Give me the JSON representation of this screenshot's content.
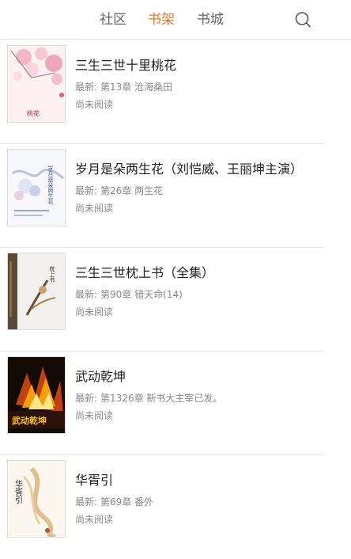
{
  "tabs": [
    {
      "label": "社区"
    },
    {
      "label": "书架"
    },
    {
      "label": "书城"
    }
  ],
  "active_tab": "书架",
  "accent_color": "#f07a2c",
  "search_icon": "search-icon",
  "books": [
    {
      "title": "三生三世十里桃花",
      "latest_prefix": "最新:",
      "latest_chapter": "第13章 沧海桑田",
      "status": "尚未阅读",
      "cover_text": "桃花"
    },
    {
      "title": "岁月是朵两生花（刘恺威、王丽坤主演）",
      "latest_prefix": "最新:",
      "latest_chapter": "第26章 两生花",
      "status": "尚未阅读",
      "cover_text": "岁月是朵两生花"
    },
    {
      "title": "三生三世枕上书（全集）",
      "latest_prefix": "最新:",
      "latest_chapter": "第90章 错天命(14)",
      "status": "尚未阅读",
      "cover_text": "枕上书"
    },
    {
      "title": "武动乾坤",
      "latest_prefix": "最新:",
      "latest_chapter": "第1326章 新书大主宰已发。",
      "status": "尚未阅读",
      "cover_text": "武动乾坤"
    },
    {
      "title": "华胥引",
      "latest_prefix": "最新:",
      "latest_chapter": "第69章 番外",
      "status": "尚未阅读",
      "cover_text": "华胥引"
    }
  ]
}
